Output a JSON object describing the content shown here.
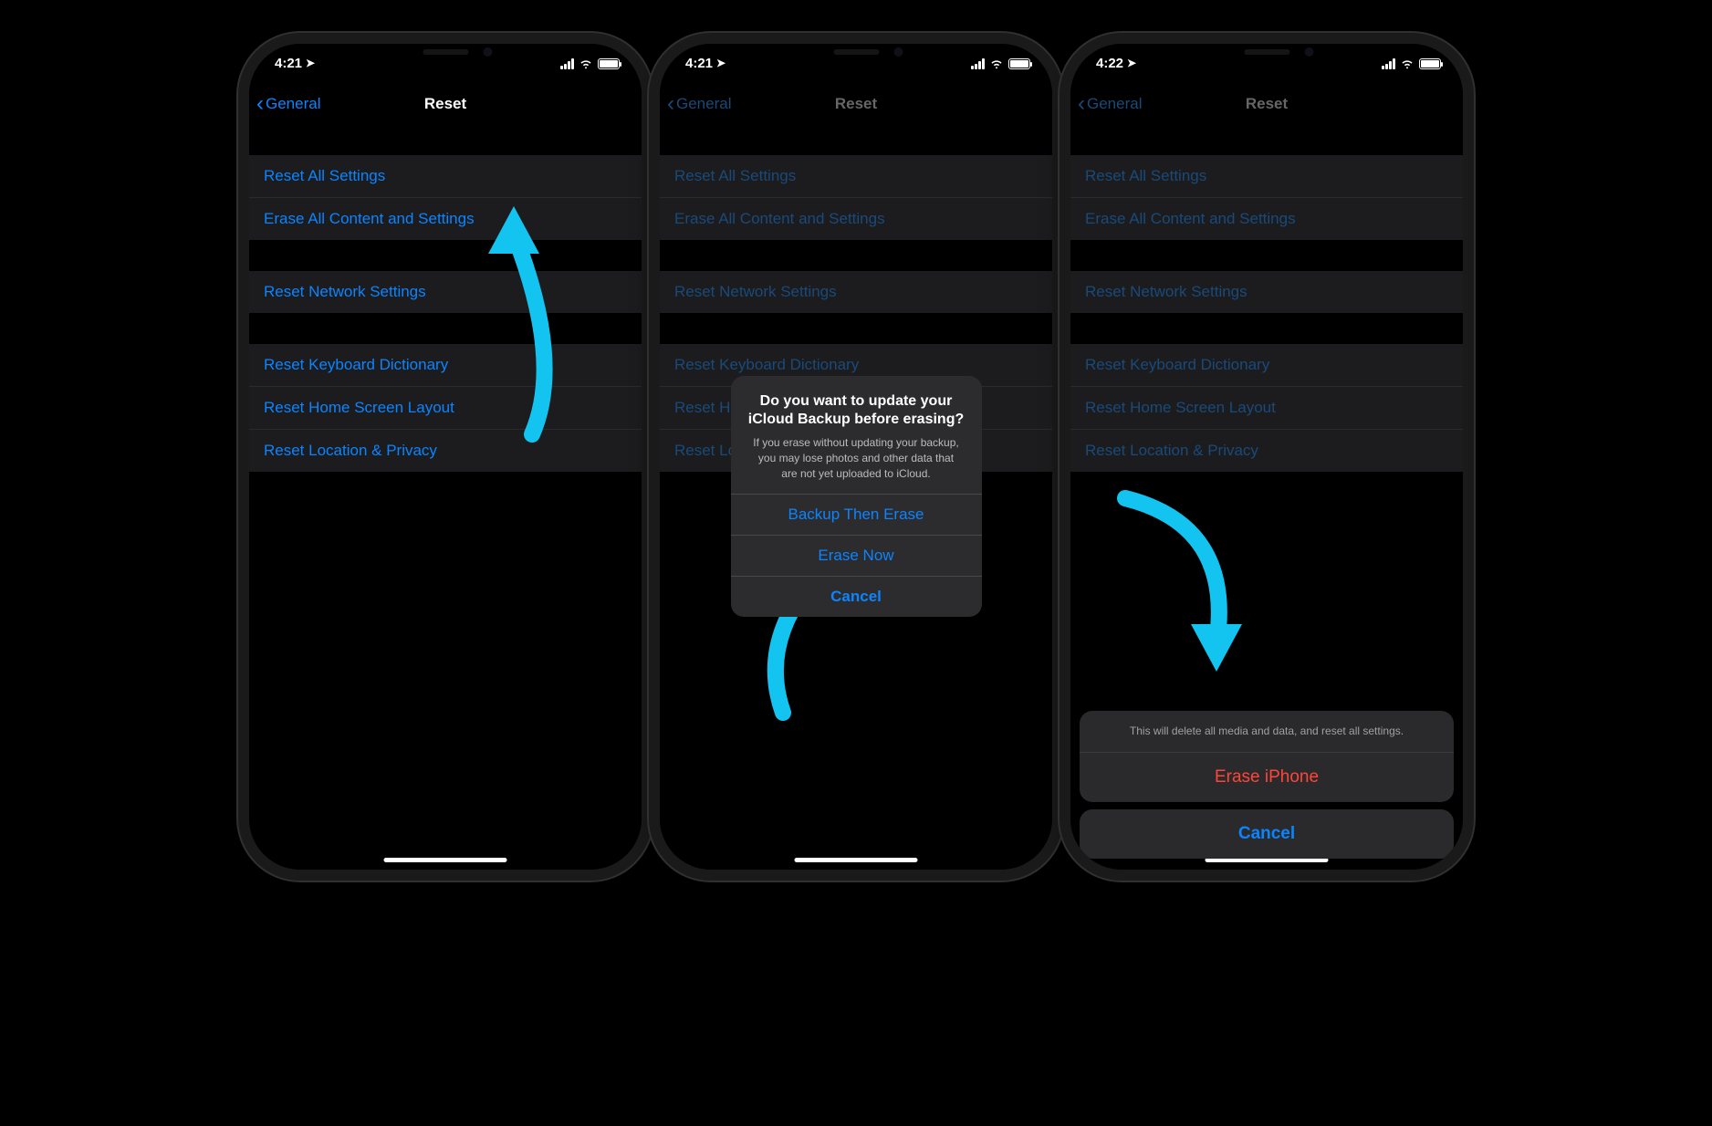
{
  "highlight_color": "#14c4f0",
  "phones": [
    {
      "time": "4:21",
      "back_label": "General",
      "title": "Reset",
      "dimmed": false,
      "groups": [
        [
          "Reset All Settings",
          "Erase All Content and Settings"
        ],
        [
          "Reset Network Settings"
        ],
        [
          "Reset Keyboard Dictionary",
          "Reset Home Screen Layout",
          "Reset Location & Privacy"
        ]
      ],
      "ring_on": "Erase All Content and Settings"
    },
    {
      "time": "4:21",
      "back_label": "General",
      "title": "Reset",
      "dimmed": true,
      "groups": [
        [
          "Reset All Settings",
          "Erase All Content and Settings"
        ],
        [
          "Reset Network Settings"
        ],
        [
          "Reset Keyboard Dictionary",
          "Reset Home Screen Layout",
          "Reset Location & Privacy"
        ]
      ],
      "alert": {
        "title": "Do you want to update your iCloud Backup before erasing?",
        "message": "If you erase without updating your backup, you may lose photos and other data that are not yet uploaded to iCloud.",
        "buttons": [
          "Backup Then Erase",
          "Erase Now",
          "Cancel"
        ],
        "ring_on": "Erase Now"
      }
    },
    {
      "time": "4:22",
      "back_label": "General",
      "title": "Reset",
      "dimmed": true,
      "groups": [
        [
          "Reset All Settings",
          "Erase All Content and Settings"
        ],
        [
          "Reset Network Settings"
        ],
        [
          "Reset Keyboard Dictionary",
          "Reset Home Screen Layout",
          "Reset Location & Privacy"
        ]
      ],
      "sheet": {
        "message": "This will delete all media and data, and reset all settings.",
        "destructive": "Erase iPhone",
        "cancel": "Cancel",
        "ring_on": "Erase iPhone"
      }
    }
  ]
}
